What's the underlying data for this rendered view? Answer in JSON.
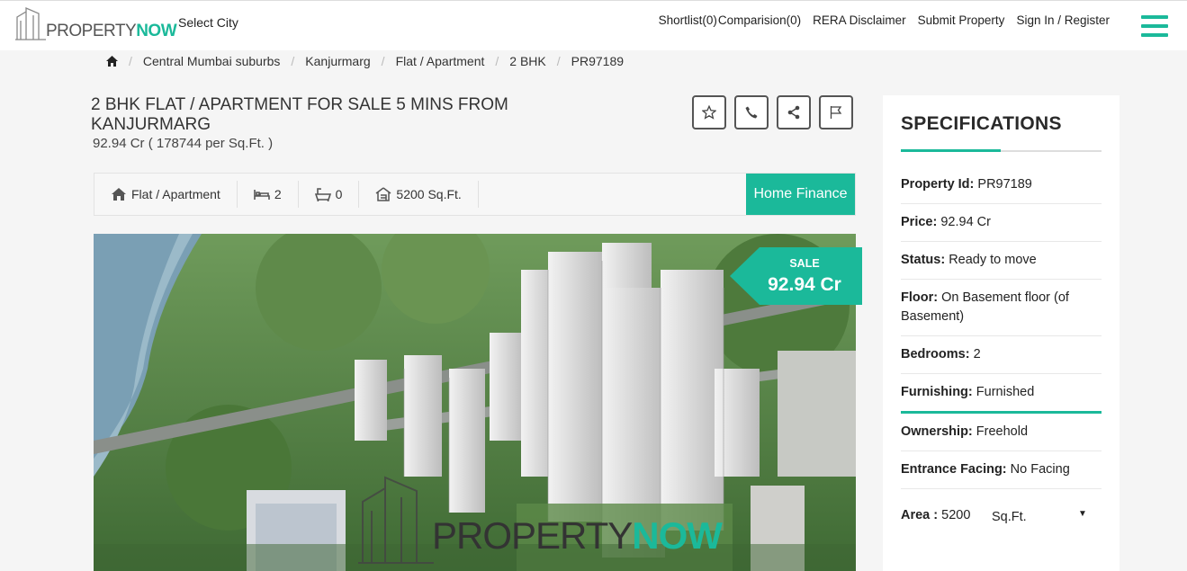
{
  "header": {
    "logo_text_a": "PROPERTY",
    "logo_text_b": "NOW",
    "select_city": "Select City",
    "nav": [
      "Shortlist(0)",
      "Comparision(0)",
      "RERA Disclaimer",
      "Submit Property",
      "Sign In / Register"
    ]
  },
  "breadcrumb": [
    "Central Mumbai suburbs",
    "Kanjurmarg",
    "Flat / Apartment",
    "2 BHK",
    "PR97189"
  ],
  "listing": {
    "title": "2 BHK Flat / Apartment for sale 5 mins from Kanjurmarg",
    "price_line": "92.94 Cr ( 178744 per Sq.Ft. )"
  },
  "features": {
    "type": "Flat / Apartment",
    "beds": "2",
    "baths": "0",
    "area": "5200 Sq.Ft.",
    "home_finance": "Home Finance"
  },
  "photo": {
    "sale_label": "SALE",
    "sale_price": "92.94 Cr",
    "watermark_a": "PROPERTY",
    "watermark_b": "NOW"
  },
  "specs": {
    "title": "SPECIFICATIONS",
    "rows": [
      {
        "label": "Property Id:",
        "value": "PR97189"
      },
      {
        "label": "Price:",
        "value": "92.94 Cr"
      },
      {
        "label": "Status:",
        "value": "Ready to move"
      },
      {
        "label": "Floor:",
        "value": "On Basement floor (of Basement)"
      },
      {
        "label": "Bedrooms:",
        "value": "2"
      },
      {
        "label": "Furnishing:",
        "value": "Furnished"
      },
      {
        "label": "Ownership:",
        "value": "Freehold"
      },
      {
        "label": "Entrance Facing:",
        "value": "No Facing"
      }
    ],
    "area_label": "Area :",
    "area_value": "5200",
    "area_unit": "Sq.Ft.",
    "area_caret": "▼"
  },
  "colors": {
    "accent": "#1bb99a"
  }
}
